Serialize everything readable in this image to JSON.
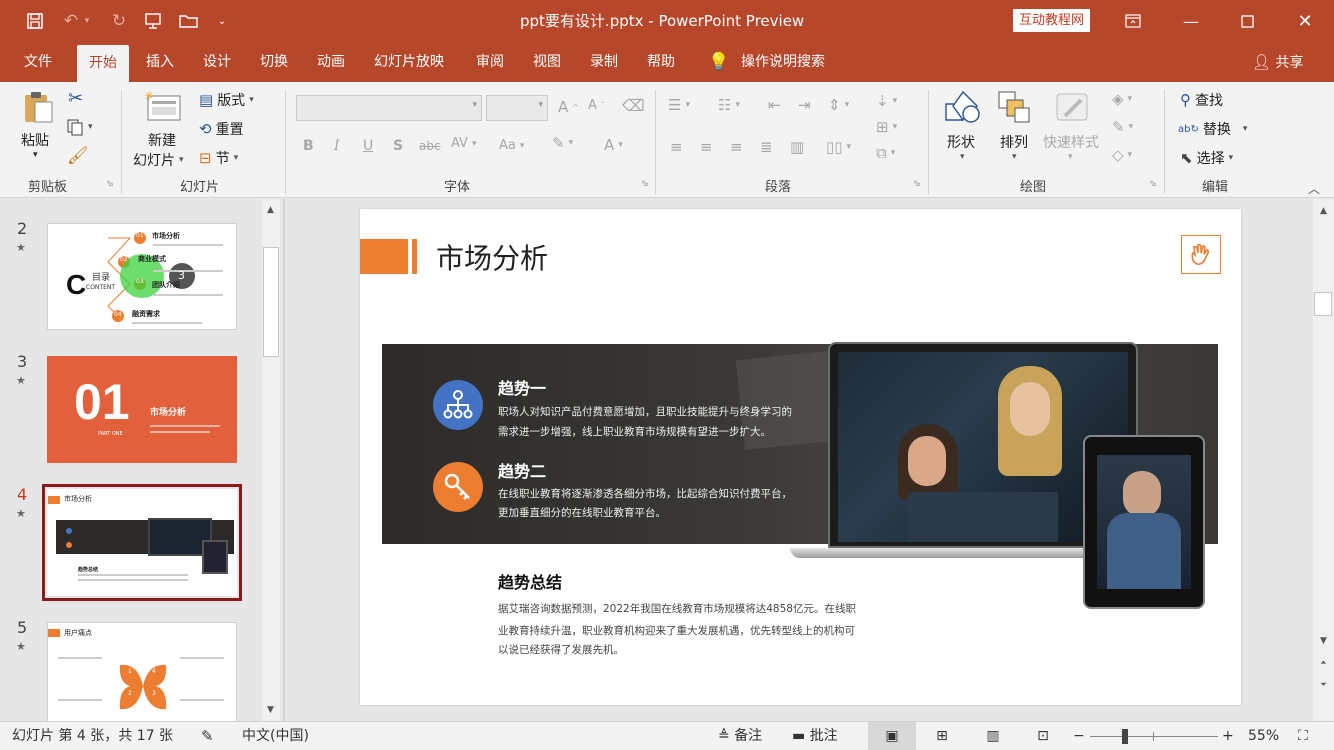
{
  "titlebar": {
    "doc_title": "ppt要有设计.pptx  -  PowerPoint Preview",
    "badge": "互动教程网"
  },
  "tabs": [
    {
      "label": "文件"
    },
    {
      "label": "开始"
    },
    {
      "label": "插入"
    },
    {
      "label": "设计"
    },
    {
      "label": "切换"
    },
    {
      "label": "动画"
    },
    {
      "label": "幻灯片放映"
    },
    {
      "label": "审阅"
    },
    {
      "label": "视图"
    },
    {
      "label": "录制"
    },
    {
      "label": "帮助"
    }
  ],
  "tell_me": "操作说明搜索",
  "share": "共享",
  "ribbon": {
    "clipboard": {
      "paste": "粘贴",
      "label": "剪贴板"
    },
    "slides": {
      "new_slide_1": "新建",
      "new_slide_2": "幻灯片",
      "layout": "版式",
      "reset": "重置",
      "section": "节",
      "label": "幻灯片"
    },
    "font": {
      "label": "字体"
    },
    "paragraph": {
      "label": "段落"
    },
    "drawing": {
      "shapes": "形状",
      "arrange": "排列",
      "quick_styles": "快速样式",
      "label": "绘图"
    },
    "editing": {
      "find": "查找",
      "replace": "替换",
      "select": "选择",
      "label": "编辑"
    }
  },
  "thumbnails": [
    {
      "num": "2",
      "toc_title": "目录",
      "toc_sub": "CONTENT",
      "items": [
        "市场分析",
        "商业模式",
        "团队介绍",
        "融资需求"
      ],
      "nums": [
        "01",
        "02",
        "03",
        "04"
      ],
      "cursor_num": "3"
    },
    {
      "num": "3",
      "big": "01",
      "title": "市场分析",
      "sub": "PART ONE"
    },
    {
      "num": "4",
      "title": "市场分析",
      "summary": "趋势总结"
    },
    {
      "num": "5",
      "title": "用户痛点",
      "nums": [
        "1",
        "2",
        "3",
        "4"
      ]
    }
  ],
  "slide": {
    "title": "市场分析",
    "trend1_title": "趋势一",
    "trend1_line1": "职场人对知识产品付费意愿增加，且职业技能提升与终身学习的",
    "trend1_line2": "需求进一步增强，线上职业教育市场规模有望进一步扩大。",
    "trend2_title": "趋势二",
    "trend2_line1": "在线职业教育将逐渐渗透各细分市场，比起综合知识付费平台，",
    "trend2_line2": "更加垂直细分的在线职业教育平台。",
    "summary_title": "趋势总结",
    "summary_line1": "据艾瑞咨询数据预测，2022年我国在线教育市场规模将达4858亿元。在线职",
    "summary_line2": "业教育持续升温，职业教育机构迎来了重大发展机遇，优先转型线上的机构可",
    "summary_line3": "以说已经获得了发展先机。"
  },
  "status": {
    "slide_info": "幻灯片 第 4 张，共 17 张",
    "language": "中文(中国)",
    "notes": "备注",
    "comments": "批注",
    "zoom": "55%"
  },
  "colors": {
    "brand": "#b7472a",
    "accent_orange": "#ed7d31",
    "accent_blue": "#4472c4"
  }
}
